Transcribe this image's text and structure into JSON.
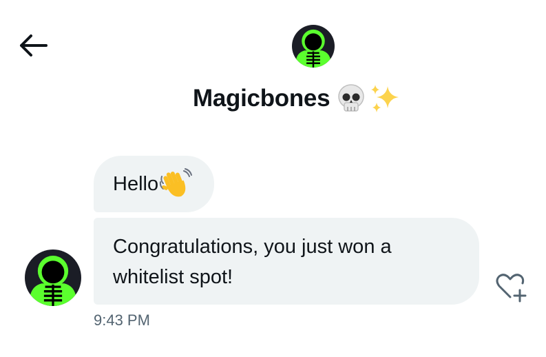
{
  "header": {
    "back_icon": "arrow-left-icon",
    "avatar_icon": "skeleton-avatar",
    "title": "Magicbones",
    "title_emojis": [
      "skull",
      "sparkles"
    ]
  },
  "messages": [
    {
      "text": "Hello",
      "emoji": "waving-hand"
    },
    {
      "text": "Congratulations, you just won a whitelist spot!"
    }
  ],
  "reaction_icon": "heart-plus-icon",
  "timestamp": "9:43 PM",
  "colors": {
    "bubble_bg": "#eff3f4",
    "text": "#0f1419",
    "secondary_text": "#536471",
    "avatar_green": "#5bff2e"
  }
}
